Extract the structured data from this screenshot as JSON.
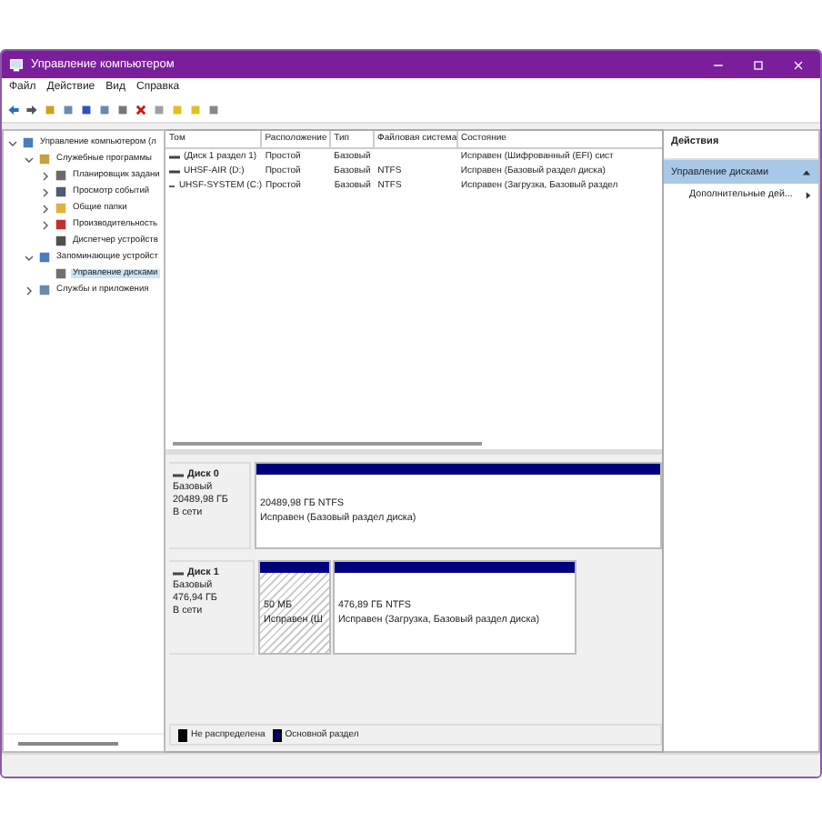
{
  "window": {
    "title": "Управление компьютером"
  },
  "menu": [
    "Файл",
    "Действие",
    "Вид",
    "Справка"
  ],
  "tree": [
    {
      "label": "Управление компьютером (л",
      "selected": false,
      "expanded": true,
      "children": [
        {
          "label": "Служебные программы",
          "selected": false,
          "expanded": true,
          "children": [
            {
              "label": "Планировщик задани",
              "selected": false,
              "expanded": false
            },
            {
              "label": "Просмотр событий",
              "selected": false,
              "expanded": false
            },
            {
              "label": "Общие папки",
              "selected": false,
              "expanded": false
            },
            {
              "label": "Производительность",
              "selected": false,
              "expanded": false
            },
            {
              "label": "Диспетчер устройств",
              "selected": false
            }
          ]
        },
        {
          "label": "Запоминающие устройст",
          "selected": false,
          "expanded": true,
          "children": [
            {
              "label": "Управление дисками",
              "selected": true
            }
          ]
        },
        {
          "label": "Службы и приложения",
          "selected": false,
          "expanded": false
        }
      ]
    }
  ],
  "table": {
    "columns": [
      "Том",
      "Расположение",
      "Тип",
      "Файловая система",
      "Состояние"
    ],
    "rows": [
      [
        "(Диск 1 раздел 1)",
        "Простой",
        "Базовый",
        "",
        "Исправен (Шифрованный (EFI) сист"
      ],
      [
        "UHSF-AIR (D:)",
        "Простой",
        "Базовый",
        "NTFS",
        "Исправен (Базовый раздел диска)"
      ],
      [
        "UHSF-SYSTEM (C:)",
        "Простой",
        "Базовый",
        "NTFS",
        "Исправен (Загрузка, Базовый раздел"
      ]
    ]
  },
  "disks": [
    {
      "name": "Диск 0",
      "type": "Базовый",
      "size": "20489,98 ГБ",
      "status": "В сети",
      "partitions": [
        {
          "size": "20489,98 ГБ NTFS",
          "status": "Исправен (Базовый раздел диска)",
          "hatched": false
        }
      ]
    },
    {
      "name": "Диск 1",
      "type": "Базовый",
      "size": "476,94 ГБ",
      "status": "В сети",
      "partitions": [
        {
          "size": "50 МБ",
          "status": "Исправен (Ш",
          "hatched": true
        },
        {
          "size": "476,89 ГБ NTFS",
          "status": "Исправен (Загрузка, Базовый раздел диска)",
          "hatched": false
        }
      ]
    }
  ],
  "legend": [
    {
      "label": "Не распределена",
      "color": "#000000"
    },
    {
      "label": "Основной раздел",
      "color": "#00007f"
    }
  ],
  "actions": {
    "title": "Действия",
    "section": "Управление дисками",
    "items": [
      "Дополнительные дей..."
    ]
  }
}
